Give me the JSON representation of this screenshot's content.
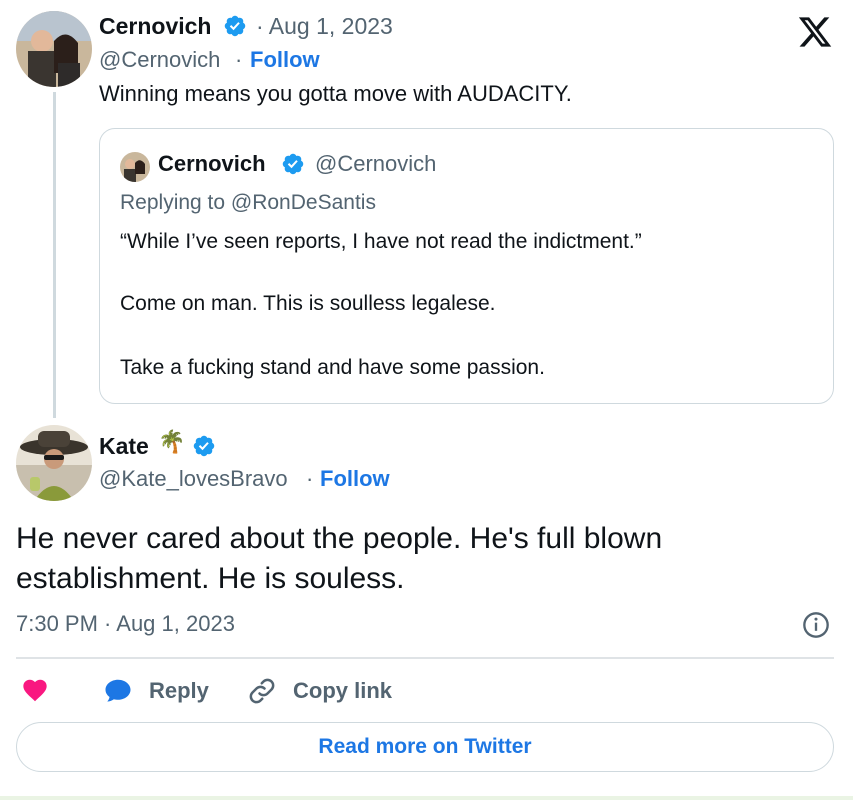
{
  "tweet": {
    "author_name": "Cernovich",
    "date": "· Aug 1, 2023",
    "handle": "@Cernovich",
    "separator": "·",
    "follow_label": "Follow",
    "text": "Winning means you gotta move with AUDACITY."
  },
  "quoted": {
    "author_name": "Cernovich",
    "handle": "@Cernovich",
    "replying_to": "Replying to @RonDeSantis",
    "line1": "“While I’ve seen reports, I have not read the indictment.”",
    "line2": "Come on man. This is soulless legalese.",
    "line3": "Take a fucking stand and have some passion."
  },
  "reply": {
    "author_name": "Kate",
    "emoji": "🌴",
    "handle": "@Kate_lovesBravo",
    "separator": "·",
    "follow_label": "Follow",
    "text_line1": "He never cared about the people. He's full blown",
    "text_line2": "establishment. He is souless.",
    "timestamp": "7:30 PM · Aug 1, 2023"
  },
  "actions": {
    "reply_label": "Reply",
    "copy_link_label": "Copy link",
    "read_more_label": "Read more on Twitter"
  },
  "icons": {
    "logo": "x-logo-icon",
    "verified": "verified-badge-icon",
    "info": "info-icon",
    "like": "heart-icon",
    "reply": "chat-bubble-icon",
    "copy_link": "link-icon"
  },
  "colors": {
    "accent": "#1d77e4",
    "verified": "#1d9bf0",
    "like": "#f91880",
    "muted_text": "#536471"
  }
}
